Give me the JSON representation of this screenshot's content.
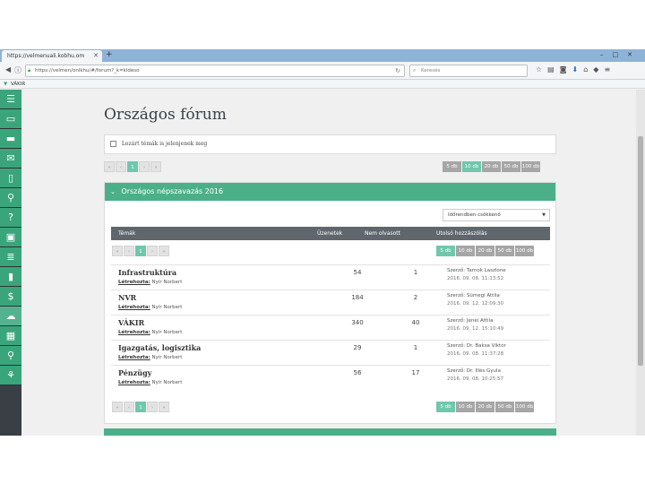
{
  "browser": {
    "tab_title": "https://velmenuali.kobhu.om",
    "url": "https://velmen/onlkhu/#/forum?_k=kldeso",
    "search_placeholder": "Keresés",
    "bookmark_label": "VÁKIR"
  },
  "page": {
    "title": "Országos fórum",
    "closed_topics_label": "Lezárt témák is jelenjenek meg"
  },
  "pager": {
    "prev_first": "«",
    "prev": "‹",
    "current": "1",
    "next": "›",
    "next_last": "»"
  },
  "per_page": [
    "5 db",
    "10 db",
    "20 db",
    "50 db",
    "100 db"
  ],
  "per_page_selected_top": "10 db",
  "per_page_selected_inner": "5 db",
  "forum": {
    "title": "Országos népszavazás 2016",
    "sort_value": "Időrendben csökkenő",
    "columns": {
      "topic": "Témák",
      "posts": "Üzenetek",
      "unread": "Nem olvasott",
      "last": "Utolsó hozzászólás"
    },
    "author_label": "Létrehozta:",
    "rows": [
      {
        "title": "Infrastruktúra",
        "author": "Nyír Norbert",
        "posts": "54",
        "unread": "1",
        "last_author": "Szerző: Tarnok Laszlone",
        "last_time": "2016. 09. 08. 11:13:52"
      },
      {
        "title": "NVR",
        "author": "Nyír Norbert",
        "posts": "184",
        "unread": "2",
        "last_author": "Szerző: Sümegi Attila",
        "last_time": "2016. 09. 12. 12:09:30"
      },
      {
        "title": "VÁKIR",
        "author": "Nyír Norbert",
        "posts": "340",
        "unread": "40",
        "last_author": "Szerző: Jenei Attila",
        "last_time": "2016. 09. 12. 15:10:49"
      },
      {
        "title": "Igazgatás, logisztika",
        "author": "Nyír Norbert",
        "posts": "29",
        "unread": "1",
        "last_author": "Szerző: Dr. Baksa Viktor",
        "last_time": "2016. 09. 08. 11:37:28"
      },
      {
        "title": "Pénzügy",
        "author": "Nyír Norbert",
        "posts": "56",
        "unread": "17",
        "last_author": "Szerző: Dr. Illés Gyula",
        "last_time": "2016. 09. 08. 10:25:57"
      }
    ]
  },
  "colors": {
    "accent": "#4bb08a",
    "sidebar": "#3a3f45",
    "table_header": "#5f666c"
  },
  "sidebar_icons": [
    "server-icon",
    "monitor-icon",
    "chat-icon",
    "mail-icon",
    "document-icon",
    "org-chart-icon",
    "help-icon",
    "briefcase-icon",
    "list-icon",
    "book-icon",
    "dollar-icon",
    "map-icon",
    "grid-icon",
    "search-icon",
    "users-icon"
  ]
}
